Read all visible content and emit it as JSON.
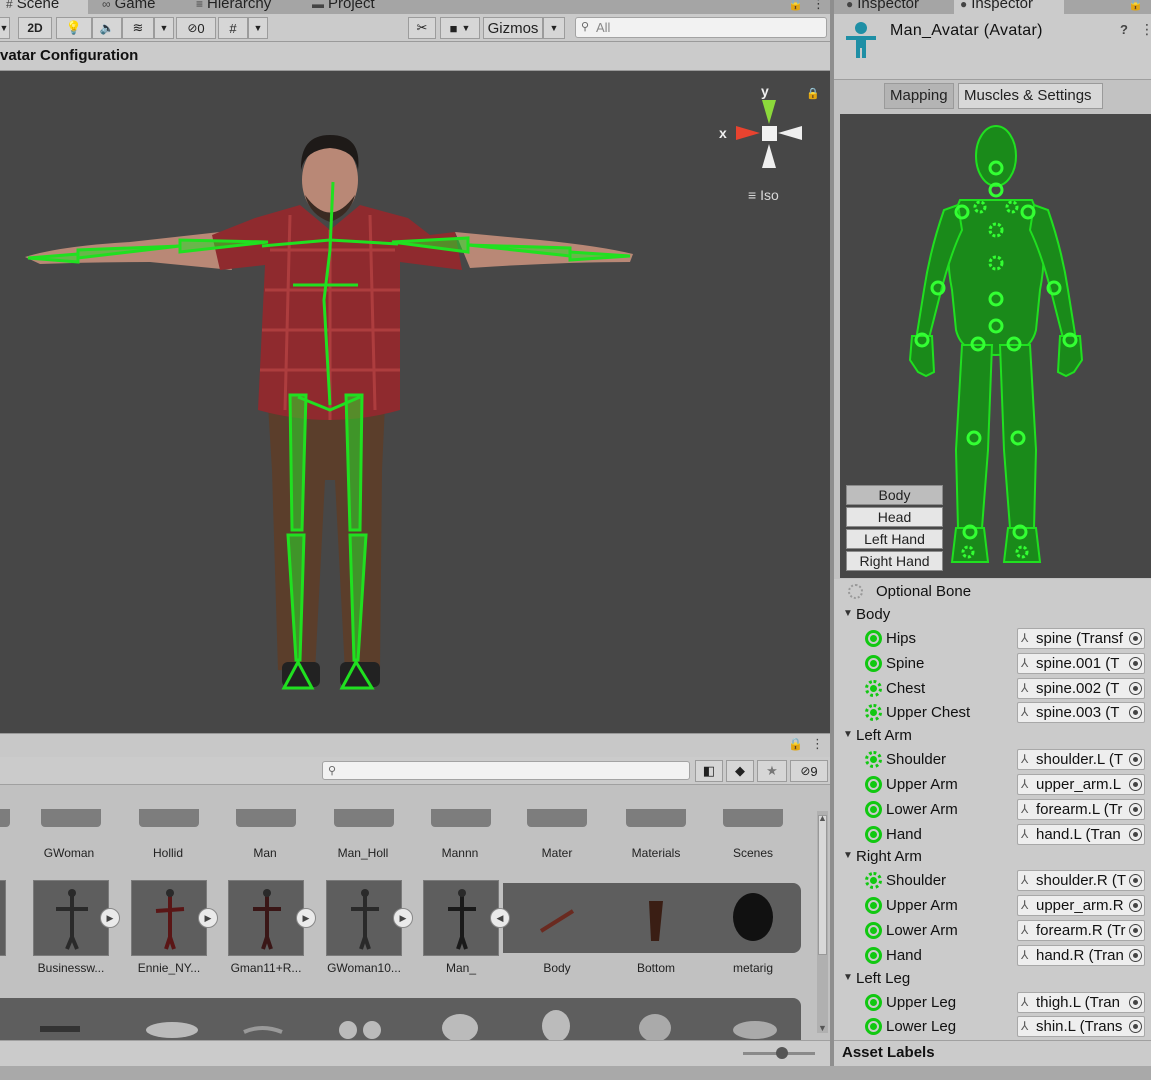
{
  "scene_tabs": [
    {
      "icon": "#",
      "label": "Scene"
    },
    {
      "icon": "∞",
      "label": "Game"
    },
    {
      "icon": "≡",
      "label": "Hierarchy"
    },
    {
      "icon": "▬",
      "label": "Project"
    }
  ],
  "toolbar": {
    "mode_2d": "2D",
    "hidden_count": "0",
    "gizmos_label": "Gizmos",
    "search_placeholder": "All"
  },
  "config_title": "vatar Configuration",
  "scene_view": {
    "axis_x": "x",
    "axis_y": "y",
    "projection_label": "Iso"
  },
  "project": {
    "folders": [
      "GWoman",
      "Hollid",
      "Man",
      "Man_Holl",
      "Mannn",
      "Mater",
      "Materials",
      "Scenes"
    ],
    "assets": [
      "Businessw...",
      "Ennie_NY...",
      "Gman11+R...",
      "GWoman10...",
      "Man_"
    ],
    "sub_assets": [
      "Body",
      "Bottom",
      "metarig"
    ],
    "hidden_count": "9"
  },
  "inspector": {
    "tabs": [
      "Inspector",
      "Inspector"
    ],
    "object_title": "Man_Avatar (Avatar)",
    "mode_tabs": [
      "Mapping",
      "Muscles & Settings"
    ],
    "view_buttons": [
      "Body",
      "Head",
      "Left Hand",
      "Right Hand"
    ],
    "optional_bone": "Optional Bone",
    "groups": [
      {
        "name": "Body",
        "bones": [
          {
            "name": "Hips",
            "value": "spine (Transf",
            "dashed": false
          },
          {
            "name": "Spine",
            "value": "spine.001 (T",
            "dashed": false
          },
          {
            "name": "Chest",
            "value": "spine.002 (T",
            "dashed": true
          },
          {
            "name": "Upper Chest",
            "value": "spine.003 (T",
            "dashed": true
          }
        ]
      },
      {
        "name": "Left Arm",
        "bones": [
          {
            "name": "Shoulder",
            "value": "shoulder.L (T",
            "dashed": true
          },
          {
            "name": "Upper Arm",
            "value": "upper_arm.L",
            "dashed": false
          },
          {
            "name": "Lower Arm",
            "value": "forearm.L (Tr",
            "dashed": false
          },
          {
            "name": "Hand",
            "value": "hand.L (Tran",
            "dashed": false
          }
        ]
      },
      {
        "name": "Right Arm",
        "bones": [
          {
            "name": "Shoulder",
            "value": "shoulder.R (T",
            "dashed": true
          },
          {
            "name": "Upper Arm",
            "value": "upper_arm.R",
            "dashed": false
          },
          {
            "name": "Lower Arm",
            "value": "forearm.R (Tr",
            "dashed": false
          },
          {
            "name": "Hand",
            "value": "hand.R (Tran",
            "dashed": false
          }
        ]
      },
      {
        "name": "Left Leg",
        "bones": [
          {
            "name": "Upper Leg",
            "value": "thigh.L (Tran",
            "dashed": false
          },
          {
            "name": "Lower Leg",
            "value": "shin.L (Trans",
            "dashed": false
          }
        ]
      }
    ],
    "asset_labels": "Asset Labels"
  },
  "colors": {
    "bone_green": "#11c811",
    "viewport_bg": "#474747",
    "panel_bg": "#cbcbcb"
  }
}
